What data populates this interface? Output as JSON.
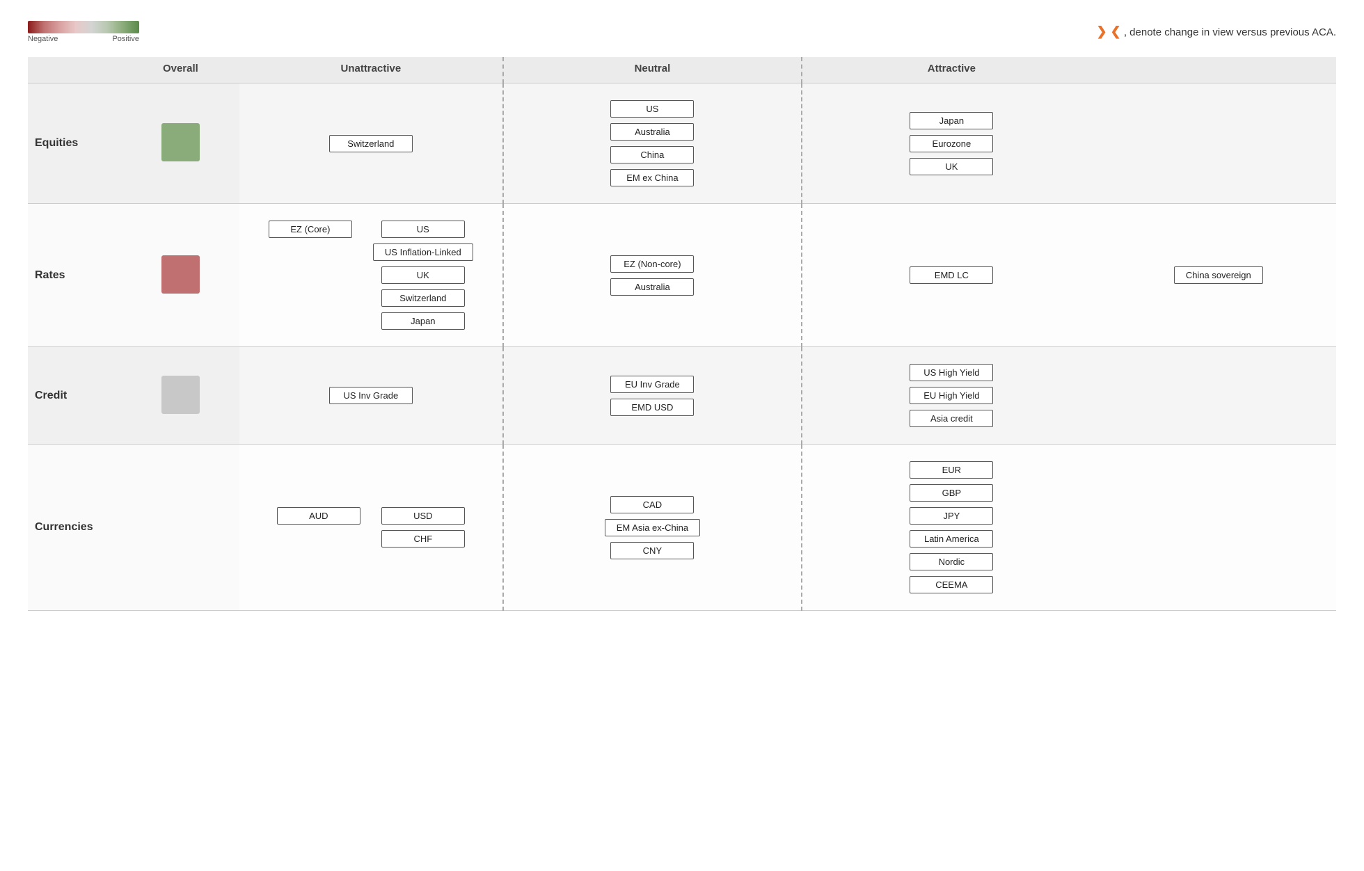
{
  "header": {
    "legend_label_negative": "Negative",
    "legend_label_positive": "Positive",
    "legend_arrow": "←————→",
    "note_text": ", denote change in view versus previous ACA.",
    "chevrons": "❯ ❮"
  },
  "columns": {
    "overall": "Overall",
    "unattractive": "Unattractive",
    "neutral": "Neutral",
    "attractive": "Attractive"
  },
  "sections": [
    {
      "id": "equities",
      "label": "Equities",
      "color": "#8aab7a",
      "unattractive": [
        "Switzerland"
      ],
      "neutral": [
        "US",
        "Australia",
        "China",
        "EM ex China"
      ],
      "attractive": [
        "Japan",
        "Eurozone",
        "UK"
      ],
      "extra_attractive": []
    },
    {
      "id": "rates",
      "label": "Rates",
      "color": "#c07070",
      "unattractive_far": [
        "EZ (Core)"
      ],
      "unattractive": [
        "US",
        "US Inflation-Linked",
        "UK",
        "Switzerland",
        "Japan"
      ],
      "neutral": [
        "EZ (Non-core)",
        "Australia"
      ],
      "attractive": [
        "EMD LC"
      ],
      "extra_attractive": [
        "China sovereign"
      ]
    },
    {
      "id": "credit",
      "label": "Credit",
      "color": "#c8c8c8",
      "unattractive_far": [],
      "unattractive": [
        "US Inv Grade"
      ],
      "neutral": [
        "EU Inv Grade",
        "EMD USD"
      ],
      "attractive": [
        "US High Yield",
        "EU High Yield",
        "Asia credit"
      ],
      "extra_attractive": []
    },
    {
      "id": "currencies",
      "label": "Currencies",
      "color": null,
      "unattractive_far": [
        "AUD"
      ],
      "unattractive": [
        "USD",
        "CHF"
      ],
      "neutral": [
        "CAD",
        "EM Asia ex-China",
        "CNY"
      ],
      "attractive": [
        "EUR",
        "GBP",
        "JPY",
        "Latin America",
        "Nordic",
        "CEEMA"
      ],
      "extra_attractive": []
    }
  ]
}
